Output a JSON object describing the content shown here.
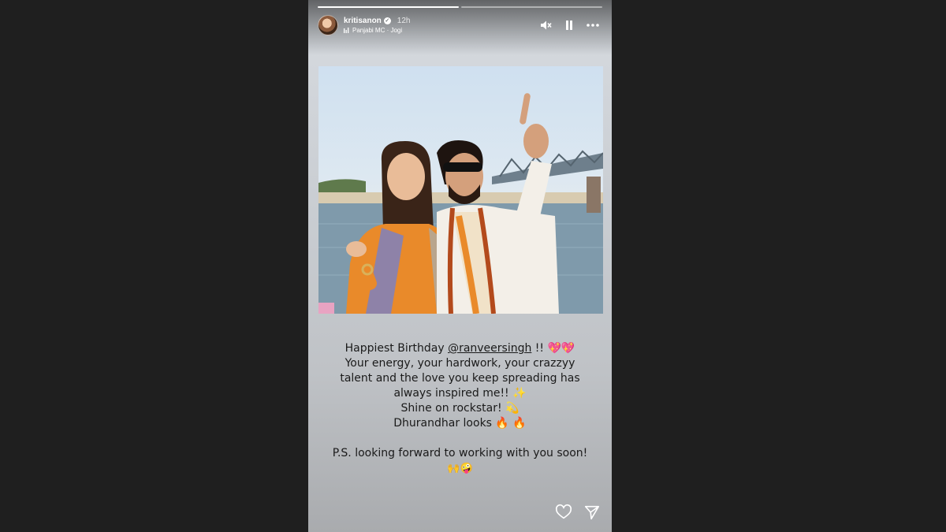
{
  "story": {
    "progress": [
      1.0,
      0.0
    ],
    "username": "kritisanon",
    "time": "12h",
    "music": "Panjabi MC · Jogi"
  },
  "icons": {
    "avatar": "profile-avatar",
    "verified": "verified-badge-icon",
    "music": "music-icon",
    "mute": "speaker-muted-icon",
    "pause": "pause-icon",
    "more": "more-icon",
    "like": "heart-icon",
    "share": "send-icon"
  },
  "caption": {
    "line1_pre": "Happiest Birthday ",
    "mention": "@ranveersingh",
    "line1_post": " !! 💖💖",
    "line2": "Your energy, your hardwork, your crazzyy",
    "line3": "talent and the love you keep spreading has",
    "line4": "always inspired me!! ✨",
    "line5": "Shine on rockstar! 💫",
    "line6": "Dhurandhar looks 🔥 🔥",
    "line7": "P.S. looking forward to working with you soon!",
    "line8": "🙌🤪"
  },
  "colors": {
    "page_bg": "#1f1f1f",
    "text": "#1a1a1a",
    "saffron": "#e98a2a"
  }
}
